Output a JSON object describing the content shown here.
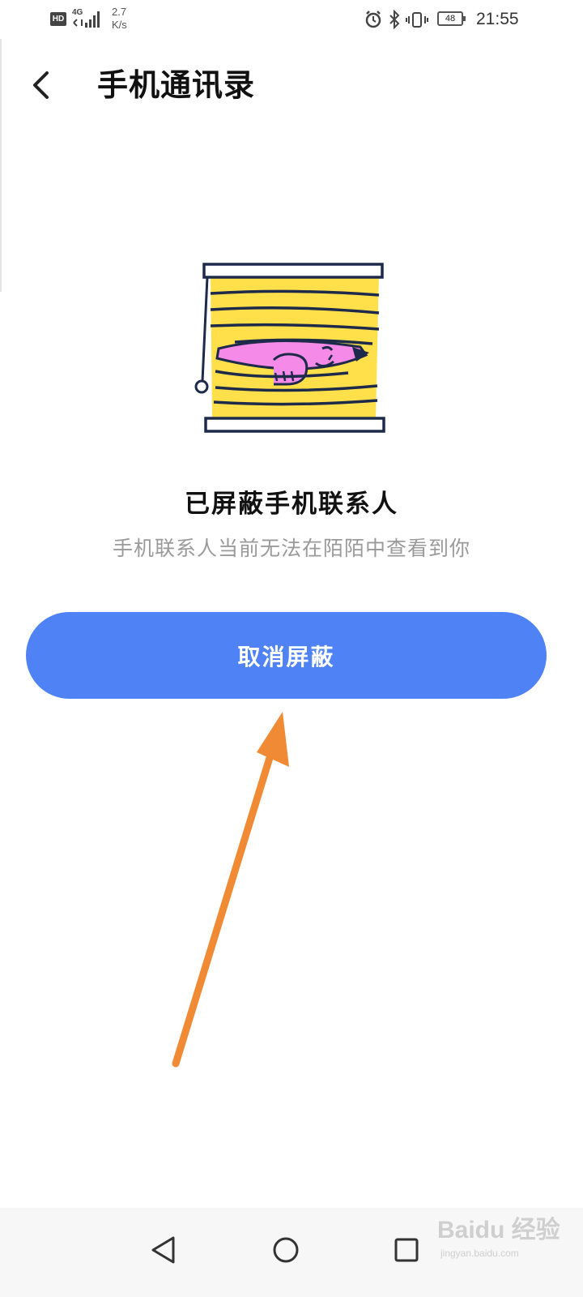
{
  "status_bar": {
    "hd_label": "HD",
    "network_label": "4G",
    "speed_value": "2.7",
    "speed_unit": "K/s",
    "battery_level": "48",
    "time": "21:55"
  },
  "header": {
    "title": "手机通讯录",
    "back_icon": "chevron-left-icon"
  },
  "main": {
    "blocked_title": "已屏蔽手机联系人",
    "blocked_description": "手机联系人当前无法在陌陌中查看到你",
    "unblock_button_label": "取消屏蔽"
  },
  "navigation": {
    "back_icon": "triangle-back-icon",
    "home_icon": "circle-home-icon",
    "recent_icon": "square-recent-icon"
  },
  "watermark": {
    "main": "Baidu 经验",
    "sub": "jingyan.baidu.com"
  },
  "colors": {
    "primary_button": "#4f82f5",
    "annotation_arrow": "#f08a34",
    "blind_yellow": "#ffe04a",
    "figure_pink": "#f58ae8",
    "outline_navy": "#1e2a4a"
  }
}
